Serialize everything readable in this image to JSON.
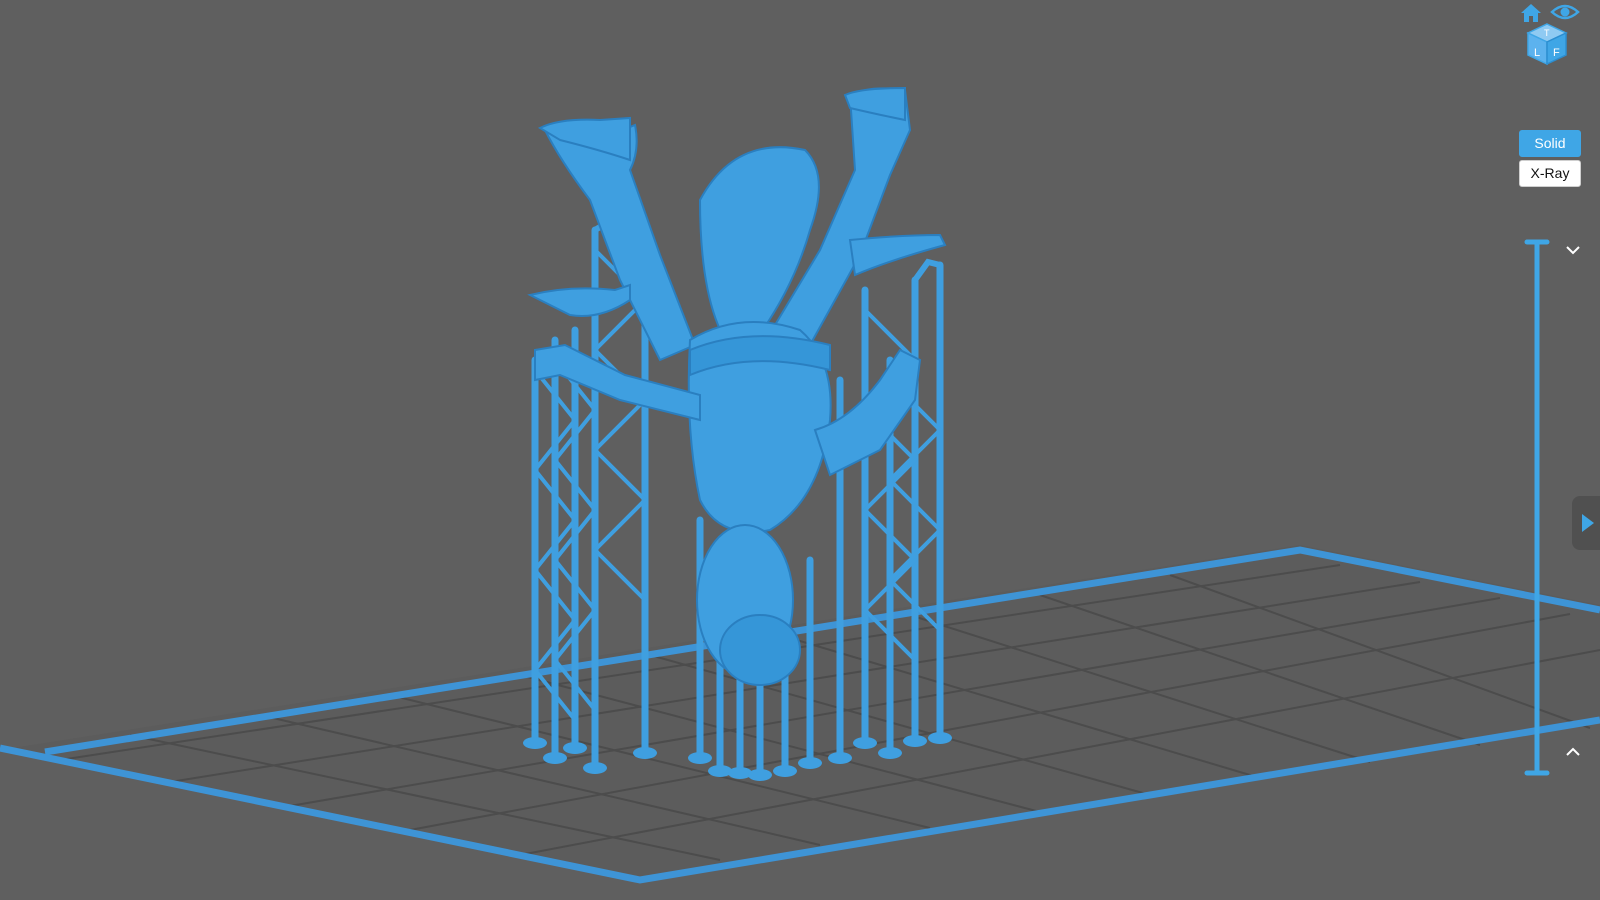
{
  "viewport": {
    "background": "#5f5f5f",
    "plate_outline_color": "#3e94d6",
    "grid_color": "#4d4d4d",
    "model_color": "#3f9fe0",
    "model_shade": "#2a7fc0"
  },
  "nav_cube": {
    "home_icon": "home-icon",
    "view_icon": "eye-icon",
    "cube_face_letters": [
      "T",
      "L",
      "F"
    ]
  },
  "view_mode": {
    "options": [
      "Solid",
      "X-Ray"
    ],
    "selected": "Solid"
  },
  "layer_slider": {
    "top_icon": "chevron-down-icon",
    "bottom_icon": "chevron-up-icon",
    "accent": "#3fa6e6"
  },
  "side_panel": {
    "toggle_icon": "play-icon"
  }
}
